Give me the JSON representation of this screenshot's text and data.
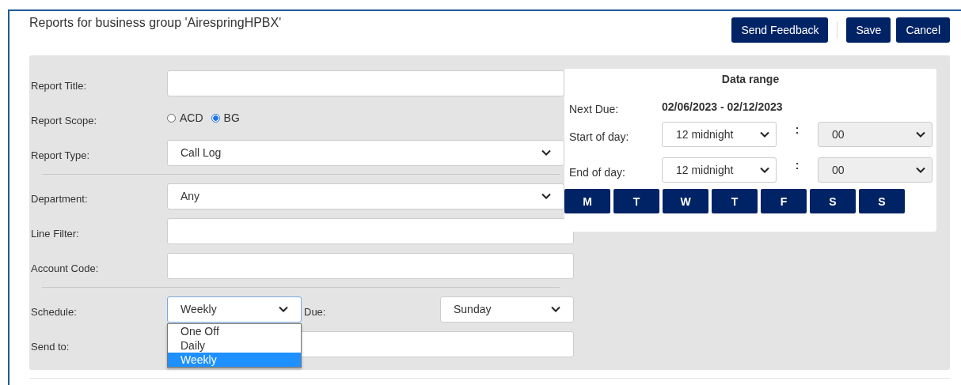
{
  "page": {
    "title": "Reports for business group 'AirespringHPBX'"
  },
  "toolbar": [
    [
      "Send Feedback"
    ],
    [
      "Save",
      "Cancel"
    ]
  ],
  "form": {
    "sections": [
      [
        {
          "kind": "text",
          "label": "Report Title:"
        },
        {
          "kind": "radio",
          "label": "Report Scope:",
          "options": [
            {
              "label": "ACD",
              "selected": false
            },
            {
              "label": "BG",
              "selected": true
            }
          ]
        },
        {
          "kind": "select",
          "label": "Report Type:",
          "value": "Call Log"
        }
      ],
      [
        {
          "kind": "select",
          "label": "Department:",
          "value": "Any"
        },
        {
          "kind": "text",
          "label": "Line Filter:"
        },
        {
          "kind": "text",
          "label": "Account Code:"
        }
      ],
      [
        {
          "kind": "schedule",
          "label": "Schedule:",
          "value": "Weekly",
          "due_label": "Due:",
          "due_value": "Sunday"
        },
        {
          "kind": "text",
          "label": "Send to:"
        }
      ]
    ],
    "schedule_dropdown": {
      "expanded": true,
      "options": [
        {
          "label": "One Off",
          "selected": false
        },
        {
          "label": "Daily",
          "selected": false
        },
        {
          "label": "Weekly",
          "selected": true
        }
      ]
    }
  },
  "data_range": {
    "title": "Data range",
    "next_due_label": "Next Due:",
    "next_due": "02/06/2023 - 02/12/2023",
    "times": [
      {
        "label": "Start of day:",
        "hour": "12 midnight",
        "hour_disabled": false,
        "separator": ":",
        "minute": "00",
        "minute_disabled": true
      },
      {
        "label": "End of day:",
        "hour": "12 midnight",
        "hour_disabled": false,
        "separator": ":",
        "minute": "00",
        "minute_disabled": true
      }
    ],
    "days": [
      "M",
      "T",
      "W",
      "T",
      "F",
      "S",
      "S"
    ]
  }
}
